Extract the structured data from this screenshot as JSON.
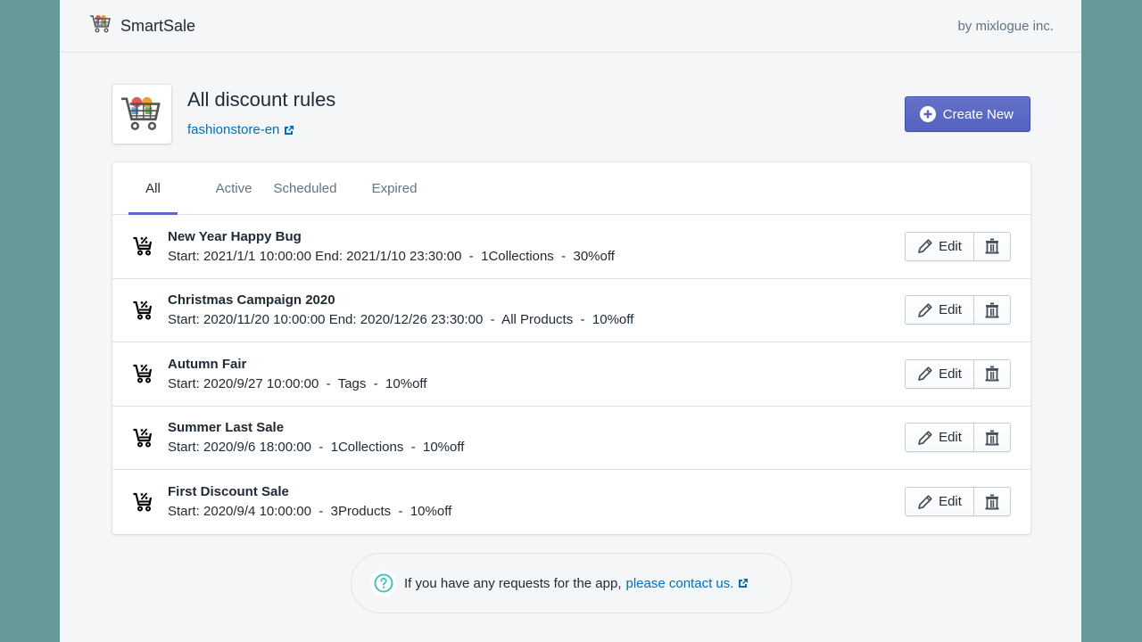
{
  "topbar": {
    "brand_name": "SmartSale",
    "vendor": "by mixlogue inc.",
    "logo_icon": "shopping-cart-icon"
  },
  "header": {
    "title": "All discount rules",
    "store_link": "fashionstore-en",
    "store_link_icon": "external-link-icon",
    "create_button": "Create New",
    "create_button_icon": "plus-circle-icon"
  },
  "tabs": [
    {
      "label": "All",
      "active": true
    },
    {
      "label": "Active",
      "active": false
    },
    {
      "label": "Scheduled",
      "active": false
    },
    {
      "label": "Expired",
      "active": false
    }
  ],
  "rules": [
    {
      "name": "New Year Happy Bug",
      "detail": "Start: 2021/1/1 10:00:00 End: 2021/1/10 23:30:00  -  1Collections  -  30%off"
    },
    {
      "name": "Christmas Campaign 2020",
      "detail": "Start: 2020/11/20 10:00:00 End: 2020/12/26 23:30:00  -  All Products  -  10%off"
    },
    {
      "name": "Autumn Fair",
      "detail": "Start: 2020/9/27 10:00:00  -  Tags  -  10%off"
    },
    {
      "name": "Summer Last Sale",
      "detail": "Start: 2020/9/6 18:00:00  -  1Collections  -  10%off"
    },
    {
      "name": "First Discount Sale",
      "detail": "Start: 2020/9/4 10:00:00  -  3Products  -  10%off"
    }
  ],
  "row_actions": {
    "edit_label": "Edit",
    "edit_icon": "pencil-icon",
    "delete_icon": "trash-icon",
    "row_icon": "discount-cart-icon"
  },
  "help": {
    "text": "If you have any requests for the app,",
    "link": "please contact us.",
    "icon": "question-circle-icon"
  },
  "colors": {
    "accent": "#5c6ac4",
    "link": "#006fbb",
    "backdrop": "#669999",
    "help_icon": "#47c1bf"
  }
}
